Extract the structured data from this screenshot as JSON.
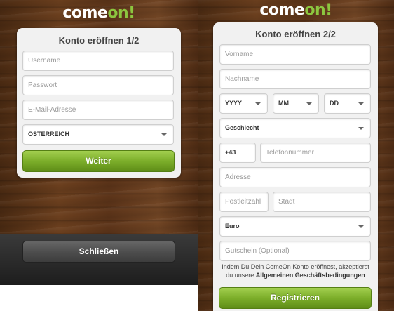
{
  "brand": {
    "logo_part1": "come",
    "logo_part2": "on!"
  },
  "step1": {
    "title": "Konto eröffnen 1/2",
    "username_placeholder": "Username",
    "password_placeholder": "Passwort",
    "email_placeholder": "E-Mail-Adresse",
    "country_value": "ÖSTERREICH",
    "next_label": "Weiter",
    "close_label": "Schließen"
  },
  "step2": {
    "title": "Konto eröffnen 2/2",
    "firstname_placeholder": "Vorname",
    "lastname_placeholder": "Nachname",
    "year_value": "YYYY",
    "month_value": "MM",
    "day_value": "DD",
    "gender_value": "Geschlecht",
    "phone_prefix": "+43",
    "phone_placeholder": "Telefonnummer",
    "address_placeholder": "Adresse",
    "zip_placeholder": "Postleitzahl",
    "city_placeholder": "Stadt",
    "currency_value": "Euro",
    "voucher_placeholder": "Gutschein (Optional)",
    "terms_text_1": "Indem Du Dein ComeOn Konto eröffnest, akzeptierst du unsere ",
    "terms_link": "Allgemeinen Geschäftsbedingungen",
    "register_label": "Registrieren"
  },
  "colors": {
    "accent_green": "#7cae2a",
    "logo_green": "#8cc63f"
  }
}
